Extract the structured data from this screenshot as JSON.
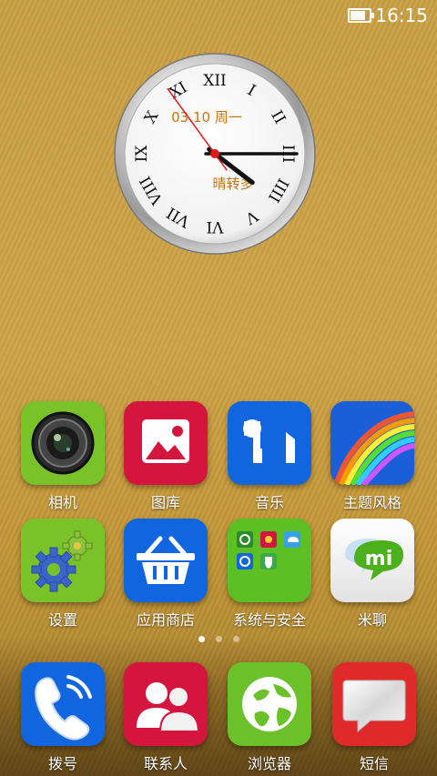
{
  "status_bar": {
    "time": "16:15",
    "battery_level": 0.85
  },
  "clock_widget": {
    "date_text": "03.10 周一",
    "weather_text": "晴转多",
    "numerals": [
      "XII",
      "I",
      "II",
      "III",
      "IIII",
      "V",
      "VI",
      "VII",
      "VIII",
      "IX",
      "X",
      "XI"
    ],
    "hour": 4,
    "minute": 15,
    "second": 54
  },
  "apps": {
    "row1": [
      {
        "label": "相机",
        "icon": "camera-icon",
        "color": "#7ac22a"
      },
      {
        "label": "图库",
        "icon": "gallery-icon",
        "color": "#d4153e"
      },
      {
        "label": "音乐",
        "icon": "music-icon",
        "color": "#1166e0"
      },
      {
        "label": "主题风格",
        "icon": "theme-rainbow-icon",
        "color": "#1a5fd8"
      }
    ],
    "row2": [
      {
        "label": "设置",
        "icon": "gears-icon",
        "color": "#7ac22a"
      },
      {
        "label": "应用商店",
        "icon": "shopping-basket-icon",
        "color": "#1166e0"
      },
      {
        "label": "系统与安全",
        "icon": "system-folder-icon",
        "color": "#5cbf23"
      },
      {
        "label": "米聊",
        "icon": "mi-chat-icon",
        "color": "#eeeeee"
      }
    ]
  },
  "page_indicator": {
    "pages": 3,
    "active": 0
  },
  "dock": [
    {
      "label": "拨号",
      "icon": "phone-icon",
      "color": "#1166e0"
    },
    {
      "label": "联系人",
      "icon": "contacts-icon",
      "color": "#d4153e"
    },
    {
      "label": "浏览器",
      "icon": "browser-globe-icon",
      "color": "#6cc02a"
    },
    {
      "label": "短信",
      "icon": "message-icon",
      "color": "#e02a2a"
    }
  ]
}
